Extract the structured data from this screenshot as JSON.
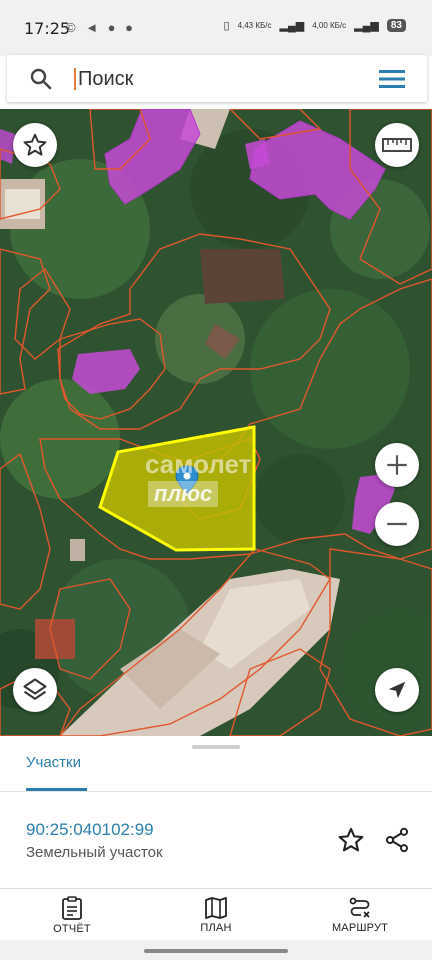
{
  "status_bar": {
    "time": "17:25",
    "notifications": "© ◄ ● ●",
    "net_speed_1": "4,43 КБ/с",
    "net_speed_2": "4,00 КБ/с",
    "battery": "83"
  },
  "search": {
    "placeholder": "Поиск",
    "value": ""
  },
  "map": {
    "watermark_line1": "самолет",
    "watermark_line2": "плюс"
  },
  "sheet": {
    "tab_label": "Участки",
    "cadastral_number": "90:25:040102:99",
    "parcel_type": "Земельный участок"
  },
  "bottom_nav": {
    "items": [
      {
        "label": "ОТЧЁТ",
        "icon": "report-icon"
      },
      {
        "label": "ПЛАН",
        "icon": "map-icon"
      },
      {
        "label": "МАРШРУТ",
        "icon": "route-icon"
      }
    ]
  },
  "colors": {
    "accent": "#2b7fb0",
    "parcel_border": "#e2572c",
    "selected_fill": "#c6c000",
    "selected_border": "#ffff00",
    "building_fill": "#c64ad6"
  }
}
